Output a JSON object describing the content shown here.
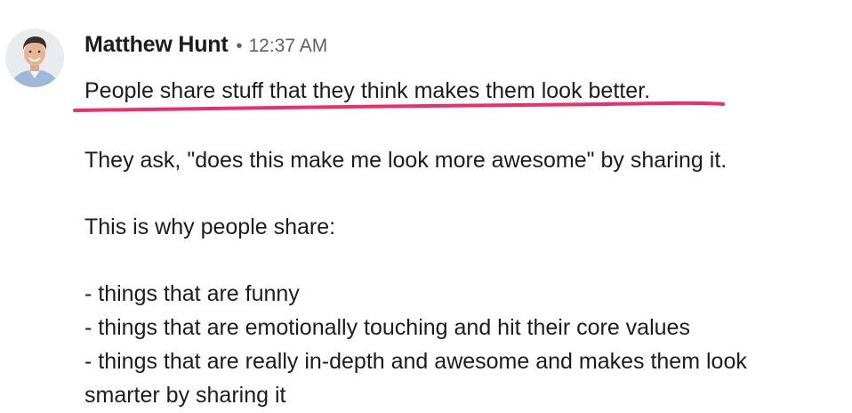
{
  "message": {
    "author": "Matthew Hunt",
    "separator": "•",
    "timestamp": "12:37 AM",
    "highlight_line": "People share stuff that they think makes them look better.",
    "paragraph_1": "They ask, \"does this make me look more awesome\" by sharing it.",
    "paragraph_2": "This is why people share:",
    "list": [
      "- things that are funny",
      "- things that are emotionally touching and hit their core values",
      "- things that are really in-depth and awesome and makes them look",
      "smarter by sharing it"
    ]
  },
  "colors": {
    "highlight_underline": "#ee2e6b",
    "timestamp": "#616061",
    "text": "#1d1c1d"
  },
  "icons": {
    "avatar": "user-avatar-photo"
  }
}
